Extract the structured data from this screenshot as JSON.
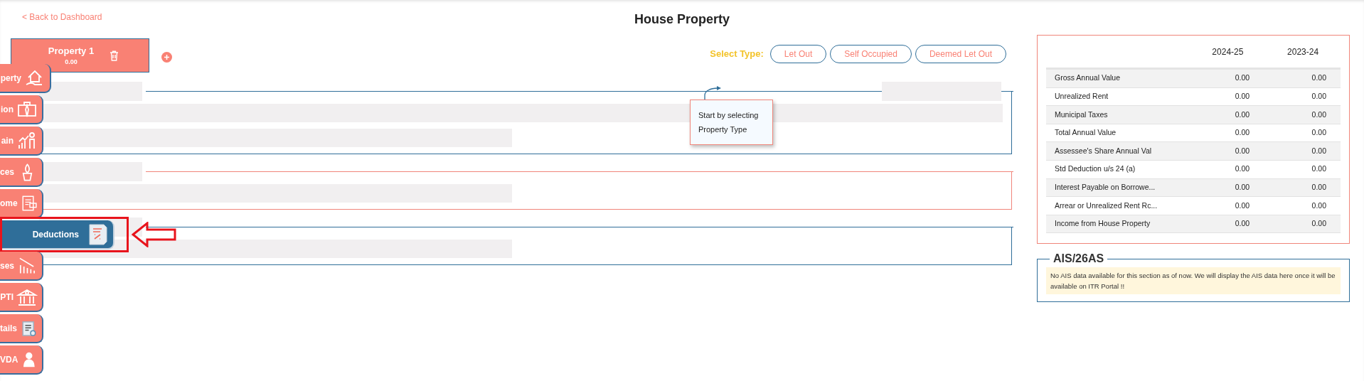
{
  "back_link": "< Back to Dashboard",
  "title": "House Property",
  "properties": [
    {
      "name": "Property 1",
      "amount": "0.00"
    }
  ],
  "select_type": {
    "label": "Select Type:",
    "options": [
      {
        "label": "Let Out",
        "selected": false
      },
      {
        "label": "Self Occupied",
        "selected": false
      },
      {
        "label": "Deemed Let Out",
        "selected": false
      }
    ]
  },
  "tooltip": "Start by selecting Property Type",
  "sidebar": [
    {
      "label": "perty",
      "selected": false
    },
    {
      "label": "ion",
      "selected": false
    },
    {
      "label": "ain",
      "selected": false
    },
    {
      "label": "ces",
      "selected": false
    },
    {
      "label": "ome",
      "selected": false
    },
    {
      "label": "Deductions",
      "selected": true
    },
    {
      "label": "ses",
      "selected": false
    },
    {
      "label": "PTI",
      "selected": false
    },
    {
      "label": "tails",
      "selected": false
    },
    {
      "label": "VDA",
      "selected": false
    }
  ],
  "summary": {
    "columns": [
      "2024-25",
      "2023-24"
    ],
    "rows": [
      {
        "label": "Gross Annual Value",
        "values": [
          "0.00",
          "0.00"
        ]
      },
      {
        "label": "Unrealized Rent",
        "values": [
          "0.00",
          "0.00"
        ]
      },
      {
        "label": "Municipal Taxes",
        "values": [
          "0.00",
          "0.00"
        ]
      },
      {
        "label": "Total Annual Value",
        "values": [
          "0.00",
          "0.00"
        ]
      },
      {
        "label": "Assessee's Share Annual Val",
        "values": [
          "0.00",
          "0.00"
        ]
      },
      {
        "label": "Std Deduction u/s 24 (a)",
        "values": [
          "0.00",
          "0.00"
        ]
      },
      {
        "label": "Interest Payable on Borrowe...",
        "values": [
          "0.00",
          "0.00"
        ]
      },
      {
        "label": "Arrear or Unrealized Rent Rc...",
        "values": [
          "0.00",
          "0.00"
        ]
      },
      {
        "label": "Income from House Property",
        "values": [
          "0.00",
          "0.00"
        ]
      }
    ]
  },
  "ais": {
    "title": "AIS/26AS",
    "message": "No AIS data available for this section as of now. We will display the AIS data here once it will be available on ITR Portal !!"
  }
}
